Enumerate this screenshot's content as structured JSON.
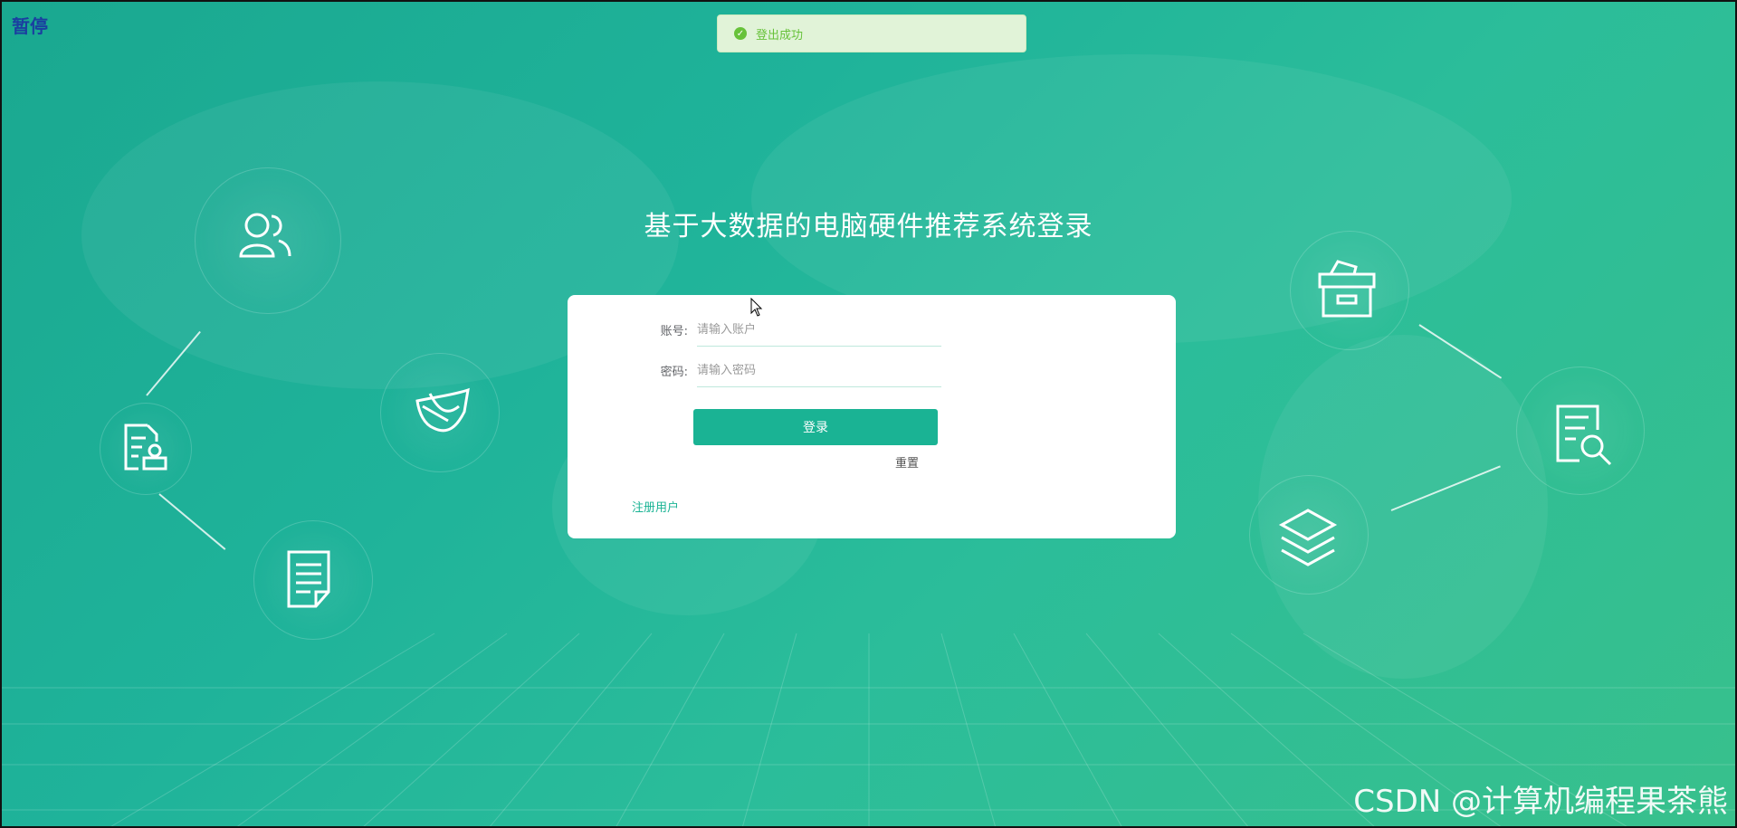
{
  "overlay": {
    "paused_label": "暂停"
  },
  "toast": {
    "message": "登出成功",
    "status_color": "#67c23a"
  },
  "page": {
    "title": "基于大数据的电脑硬件推荐系统登录"
  },
  "form": {
    "account_label": "账号:",
    "account_placeholder": "请输入账户",
    "account_value": "",
    "password_label": "密码:",
    "password_placeholder": "请输入密码",
    "password_value": "",
    "login_label": "登录",
    "reset_label": "重置",
    "register_label": "注册用户"
  },
  "theme": {
    "accent": "#1ab394",
    "background": "#1fb39a"
  },
  "decor_icons": [
    "users-icon",
    "certificate-icon",
    "feather-paper-icon",
    "document-icon",
    "archive-box-icon",
    "document-search-icon",
    "layers-icon"
  ],
  "watermark": "CSDN @计算机编程果茶熊"
}
